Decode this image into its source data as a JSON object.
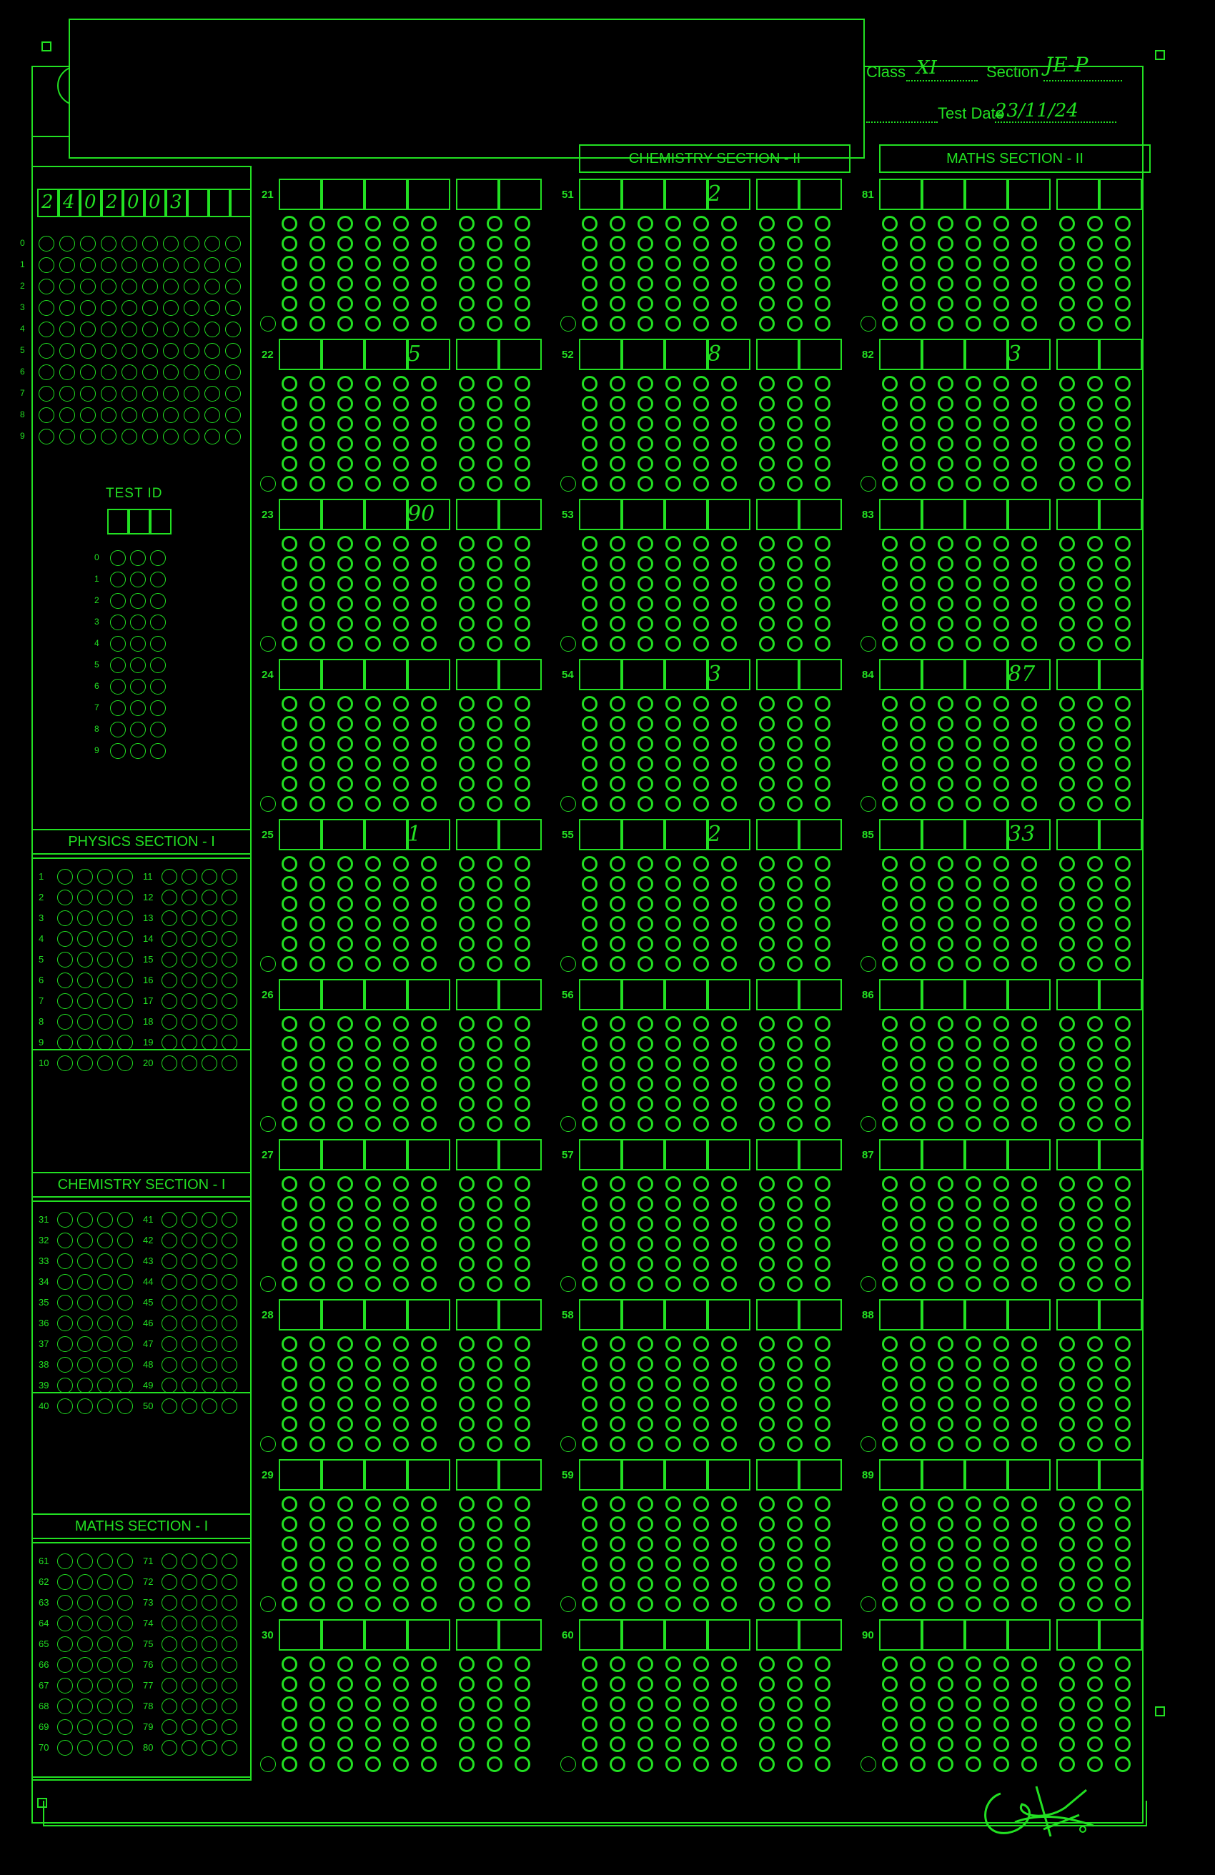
{
  "header": {
    "class_label": "Class",
    "class_value": "XI",
    "section_label": "Section",
    "section_value": "JE-P",
    "test_date_label": "Test Date",
    "test_date_value": "23/11/24"
  },
  "roll_number": {
    "written_digits": [
      "2",
      "4",
      "0",
      "2",
      "0",
      "0",
      "3"
    ],
    "digit_labels": [
      "0",
      "1",
      "2",
      "3",
      "4",
      "5",
      "6",
      "7",
      "8",
      "9"
    ]
  },
  "test_id": {
    "title": "TEST ID",
    "digit_labels": [
      "0",
      "1",
      "2",
      "3",
      "4",
      "5",
      "6",
      "7",
      "8",
      "9"
    ]
  },
  "section_one": [
    {
      "title": "PHYSICS SECTION - I",
      "left_questions": [
        "1",
        "2",
        "3",
        "4",
        "5",
        "6",
        "7",
        "8",
        "9",
        "10"
      ],
      "right_questions": [
        "11",
        "12",
        "13",
        "14",
        "15",
        "16",
        "17",
        "18",
        "19",
        "20"
      ]
    },
    {
      "title": "CHEMISTRY SECTION - I",
      "left_questions": [
        "31",
        "32",
        "33",
        "34",
        "35",
        "36",
        "37",
        "38",
        "39",
        "40"
      ],
      "right_questions": [
        "41",
        "42",
        "43",
        "44",
        "45",
        "46",
        "47",
        "48",
        "49",
        "50"
      ]
    },
    {
      "title": "MATHS SECTION - I",
      "left_questions": [
        "61",
        "62",
        "63",
        "64",
        "65",
        "66",
        "67",
        "68",
        "69",
        "70"
      ],
      "right_questions": [
        "71",
        "72",
        "73",
        "74",
        "75",
        "76",
        "77",
        "78",
        "79",
        "80"
      ]
    }
  ],
  "section_two": [
    {
      "title": "",
      "numbers": [
        "21",
        "22",
        "23",
        "24",
        "25",
        "26",
        "27",
        "28",
        "29",
        "30"
      ],
      "answers": [
        "",
        "5",
        "90",
        "",
        "1",
        "",
        "",
        "",
        "",
        ""
      ]
    },
    {
      "title": "CHEMISTRY SECTION - II",
      "numbers": [
        "51",
        "52",
        "53",
        "54",
        "55",
        "56",
        "57",
        "58",
        "59",
        "60"
      ],
      "answers": [
        "2",
        "8",
        "",
        "3",
        "2",
        "",
        "",
        "",
        "",
        ""
      ]
    },
    {
      "title": "MATHS SECTION - II",
      "numbers": [
        "81",
        "82",
        "83",
        "84",
        "85",
        "86",
        "87",
        "88",
        "89",
        "90"
      ],
      "answers": [
        "",
        "3",
        "",
        "87",
        "33",
        "",
        "",
        "",
        "",
        ""
      ]
    }
  ]
}
